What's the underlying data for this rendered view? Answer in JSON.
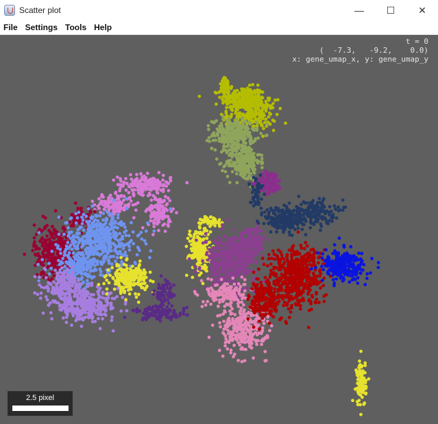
{
  "window": {
    "title": "Scatter plot",
    "minimize_glyph": "—",
    "maximize_glyph": "☐",
    "close_glyph": "✕"
  },
  "menu": {
    "items": [
      "File",
      "Settings",
      "Tools",
      "Help"
    ]
  },
  "readout": {
    "time_line": "t = 0",
    "coord_line": "(  -7.3,   -9.2,    0.0)",
    "axes_line": "x: gene_umap_x, y: gene_umap_y"
  },
  "scalebar": {
    "label": "2.5 pixel"
  },
  "plot": {
    "background": "#5f5f5f"
  },
  "chart_data": {
    "type": "scatter",
    "xlabel": "gene_umap_x",
    "ylabel": "gene_umap_y",
    "xlim": [
      0,
      100
    ],
    "ylim": [
      0,
      100
    ],
    "grid": false,
    "legend": "none",
    "series": [
      {
        "color": "#b5bd00",
        "clusters": [
          {
            "cx": 55.5,
            "cy": 83.5,
            "rx": 4.5,
            "ry": 2.8,
            "n": 260
          },
          {
            "cx": 57.5,
            "cy": 79.5,
            "rx": 5.0,
            "ry": 3.5,
            "n": 200
          },
          {
            "cx": 51.5,
            "cy": 86.5,
            "rx": 1.3,
            "ry": 2.2,
            "n": 60
          }
        ]
      },
      {
        "color": "#8fa55c",
        "clusters": [
          {
            "cx": 53.5,
            "cy": 74.5,
            "rx": 4.5,
            "ry": 3.5,
            "n": 260
          },
          {
            "cx": 55.5,
            "cy": 67.5,
            "rx": 3.5,
            "ry": 4.5,
            "n": 260
          }
        ]
      },
      {
        "color": "#8c2e8e",
        "clusters": [
          {
            "cx": 61.5,
            "cy": 62.0,
            "rx": 2.6,
            "ry": 2.6,
            "n": 130
          }
        ]
      },
      {
        "color": "#d97ad8",
        "clusters": [
          {
            "cx": 33.0,
            "cy": 61.5,
            "rx": 5.5,
            "ry": 2.2,
            "n": 170
          },
          {
            "cx": 26.0,
            "cy": 56.5,
            "rx": 4.0,
            "ry": 2.2,
            "n": 130
          },
          {
            "cx": 36.5,
            "cy": 54.5,
            "rx": 2.4,
            "ry": 4.0,
            "n": 130
          }
        ]
      },
      {
        "color": "#9b0032",
        "clusters": [
          {
            "cx": 12.5,
            "cy": 44.5,
            "rx": 4.2,
            "ry": 6.5,
            "n": 320
          },
          {
            "cx": 18.5,
            "cy": 53.0,
            "rx": 2.0,
            "ry": 2.5,
            "n": 70
          }
        ]
      },
      {
        "color": "#6f94f0",
        "clusters": [
          {
            "cx": 23.0,
            "cy": 47.5,
            "rx": 8.0,
            "ry": 6.5,
            "n": 470
          },
          {
            "cx": 18.0,
            "cy": 40.5,
            "rx": 5.5,
            "ry": 4.0,
            "n": 220
          }
        ]
      },
      {
        "color": "#a77ee0",
        "clusters": [
          {
            "cx": 19.5,
            "cy": 30.5,
            "rx": 7.0,
            "ry": 3.5,
            "n": 330
          },
          {
            "cx": 14.5,
            "cy": 35.5,
            "rx": 4.0,
            "ry": 3.5,
            "n": 150
          }
        ]
      },
      {
        "color": "#e6e22e",
        "clusters": [
          {
            "cx": 29.5,
            "cy": 37.5,
            "rx": 3.8,
            "ry": 3.2,
            "n": 230
          },
          {
            "cx": 45.5,
            "cy": 45.0,
            "rx": 2.2,
            "ry": 5.0,
            "n": 190
          },
          {
            "cx": 48.5,
            "cy": 52.0,
            "rx": 2.4,
            "ry": 1.2,
            "n": 50
          },
          {
            "cx": 82.5,
            "cy": 10.5,
            "rx": 1.0,
            "ry": 5.5,
            "n": 90
          }
        ]
      },
      {
        "color": "#5a2a87",
        "clusters": [
          {
            "cx": 36.5,
            "cy": 28.5,
            "rx": 5.5,
            "ry": 1.6,
            "n": 110
          },
          {
            "cx": 37.5,
            "cy": 33.5,
            "rx": 2.0,
            "ry": 3.0,
            "n": 60
          }
        ]
      },
      {
        "color": "#8c3f91",
        "clusters": [
          {
            "cx": 52.5,
            "cy": 41.5,
            "rx": 5.5,
            "ry": 6.5,
            "n": 380
          },
          {
            "cx": 57.5,
            "cy": 47.0,
            "rx": 3.0,
            "ry": 3.5,
            "n": 140
          }
        ]
      },
      {
        "color": "#e487b8",
        "clusters": [
          {
            "cx": 55.5,
            "cy": 24.5,
            "rx": 4.8,
            "ry": 5.5,
            "n": 300
          },
          {
            "cx": 51.5,
            "cy": 33.5,
            "rx": 4.0,
            "ry": 3.0,
            "n": 160
          }
        ]
      },
      {
        "color": "#223a66",
        "clusters": [
          {
            "cx": 65.0,
            "cy": 52.5,
            "rx": 4.0,
            "ry": 3.0,
            "n": 200
          },
          {
            "cx": 71.5,
            "cy": 54.5,
            "rx": 4.5,
            "ry": 3.0,
            "n": 170
          },
          {
            "cx": 58.5,
            "cy": 59.5,
            "rx": 1.4,
            "ry": 3.5,
            "n": 50
          }
        ]
      },
      {
        "color": "#b30000",
        "clusters": [
          {
            "cx": 67.5,
            "cy": 38.0,
            "rx": 5.5,
            "ry": 7.0,
            "n": 540
          },
          {
            "cx": 60.5,
            "cy": 32.0,
            "rx": 3.2,
            "ry": 5.0,
            "n": 200
          }
        ]
      },
      {
        "color": "#0a14e0",
        "clusters": [
          {
            "cx": 78.5,
            "cy": 40.5,
            "rx": 4.5,
            "ry": 3.5,
            "n": 280
          }
        ]
      }
    ]
  }
}
